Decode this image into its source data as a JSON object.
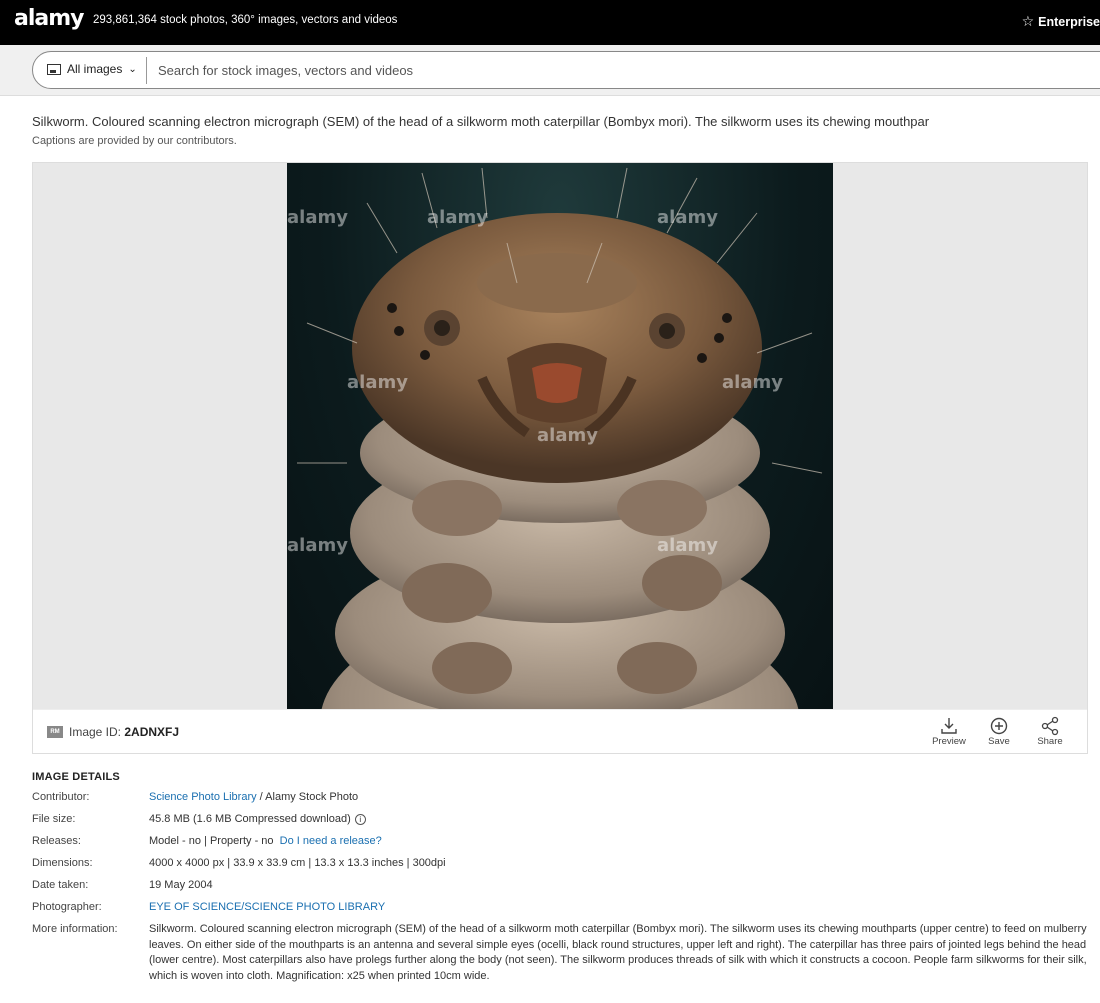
{
  "header": {
    "logo": "alamy",
    "tagline": "293,861,364 stock photos, 360° images, vectors and videos",
    "enterprise_label": "Enterprise"
  },
  "search": {
    "scope_label": "All images",
    "placeholder": "Search for stock images, vectors and videos"
  },
  "caption": {
    "text": "Silkworm. Coloured scanning electron micrograph (SEM) of the head of a silkworm moth caterpillar (Bombyx mori). The silkworm uses its chewing mouthpar",
    "note": "Captions are provided by our contributors."
  },
  "viewer": {
    "watermark": "alamy",
    "license_badge": "RM",
    "image_id_label": "Image ID:",
    "image_id": "2ADNXFJ",
    "actions": {
      "preview": "Preview",
      "save": "Save",
      "share": "Share"
    }
  },
  "details": {
    "title": "IMAGE DETAILS",
    "contributor_label": "Contributor:",
    "contributor_link": "Science Photo Library",
    "contributor_suffix": " / Alamy Stock Photo",
    "filesize_label": "File size:",
    "filesize_value": "45.8 MB (1.6 MB Compressed download)",
    "releases_label": "Releases:",
    "releases_value": "Model - no | Property - no",
    "releases_link": "Do I need a release?",
    "dimensions_label": "Dimensions:",
    "dimensions_value": "4000 x 4000 px | 33.9 x 33.9 cm | 13.3 x 13.3 inches | 300dpi",
    "date_label": "Date taken:",
    "date_value": "19 May 2004",
    "photographer_label": "Photographer:",
    "photographer_link": "EYE OF SCIENCE/SCIENCE PHOTO LIBRARY",
    "more_label": "More information:",
    "more_value": "Silkworm. Coloured scanning electron micrograph (SEM) of the head of a silkworm moth caterpillar (Bombyx mori). The silkworm uses its chewing mouthparts (upper centre) to feed on mulberry leaves. On either side of the mouthparts is an antenna and several simple eyes (ocelli, black round structures, upper left and right). The caterpillar has three pairs of jointed legs behind the head (lower centre). Most caterpillars also have prolegs further along the body (not seen). The silkworm produces threads of silk with which it constructs a cocoon. People farm silkworms for their silk, which is woven into cloth. Magnification: x25 when printed 10cm wide."
  }
}
